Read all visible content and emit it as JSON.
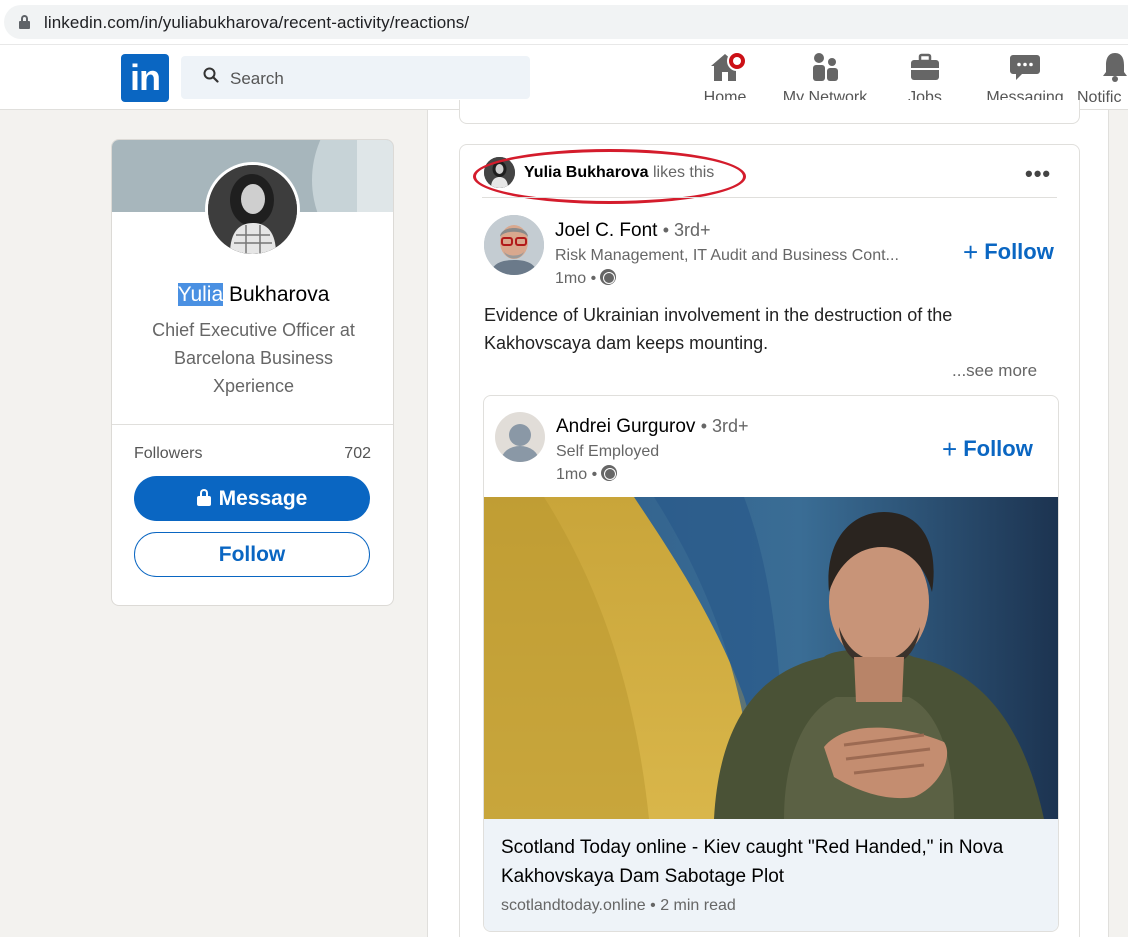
{
  "browser": {
    "url": "linkedin.com/in/yuliabukharova/recent-activity/reactions/"
  },
  "nav": {
    "logo": "in",
    "search_placeholder": "Search",
    "items": [
      {
        "label": "Home",
        "icon": "home-icon"
      },
      {
        "label": "My Network",
        "icon": "network-icon"
      },
      {
        "label": "Jobs",
        "icon": "briefcase-icon"
      },
      {
        "label": "Messaging",
        "icon": "messaging-icon"
      },
      {
        "label": "Notific",
        "icon": "bell-icon"
      }
    ]
  },
  "profile": {
    "first_name": "Yulia",
    "last_name": "Bukharova",
    "headline": "Chief Executive Officer at Barcelona Business Xperience",
    "followers_label": "Followers",
    "followers_count": "702",
    "message_label": "Message",
    "follow_label": "Follow"
  },
  "post": {
    "liker_name": "Yulia Bukharova",
    "liker_action": "likes this",
    "more": "•••",
    "author": {
      "name": "Joel C. Font",
      "degree": "• 3rd+",
      "description": "Risk Management, IT Audit and Business Cont...",
      "time": "1mo •"
    },
    "follow_label": "Follow",
    "text": "Evidence of Ukrainian involvement in the destruction of the Kakhovscaya dam keeps mounting.",
    "see_more": "...see more",
    "shared": {
      "author": {
        "name": "Andrei Gurgurov",
        "degree": "• 3rd+",
        "description": "Self Employed",
        "time": "1mo •"
      },
      "follow_label": "Follow",
      "article_title": "Scotland Today online - Kiev caught \"Red Handed,\" in Nova Kakhovskaya Dam Sabotage Plot",
      "article_source": "scotlandtoday.online • 2 min read"
    }
  },
  "colors": {
    "brand": "#0a66c2",
    "highlight": "#4a90e2",
    "annotation": "#d41c2c",
    "notification": "#cc1016"
  }
}
